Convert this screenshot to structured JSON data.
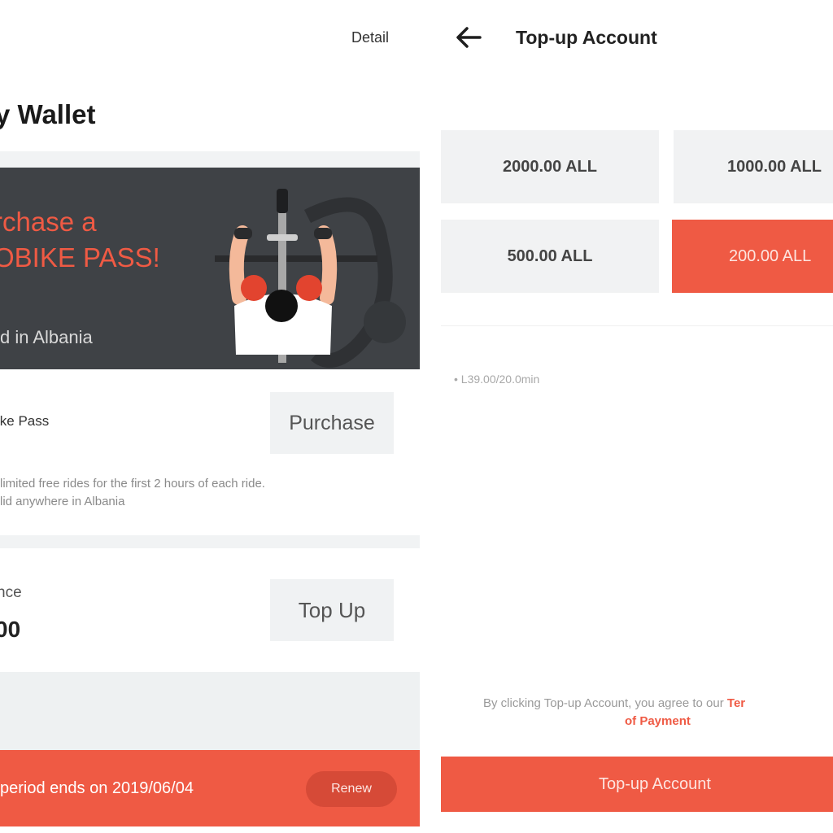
{
  "wallet": {
    "detail_link": "Detail",
    "title": "y Wallet",
    "banner": {
      "line1": "rchase a",
      "line2": "OBIKE PASS!",
      "line3": "d in Albania",
      "illustration": "cyclist-top-view-illustration"
    },
    "pass": {
      "label": "ike Pass",
      "purchase_label": "Purchase",
      "desc_line1": "limited free rides for the first 2 hours of each ride.",
      "desc_line2": "lid anywhere in Albania"
    },
    "balance": {
      "label": "nce",
      "value": "00",
      "topup_label": "Top Up"
    },
    "period": {
      "text": "period ends on 2019/06/04",
      "renew_label": "Renew"
    }
  },
  "topup": {
    "back_icon": "arrow-left-icon",
    "title": "Top-up Account",
    "amounts": [
      {
        "label": "2000.00 ALL",
        "selected": false
      },
      {
        "label": "1000.00 ALL",
        "selected": false
      },
      {
        "label": "500.00 ALL",
        "selected": false
      },
      {
        "label": "200.00 ALL",
        "selected": true
      }
    ],
    "rate": "• L39.00/20.0min",
    "agreement_prefix": "By clicking Top-up Account, you agree to our ",
    "agreement_link1": "Ter",
    "agreement_link2": "of Payment",
    "submit_label": "Top-up Account"
  },
  "colors": {
    "accent": "#ef5a44",
    "banner_bg": "#3f4246",
    "tile_bg": "#f1f2f3"
  }
}
